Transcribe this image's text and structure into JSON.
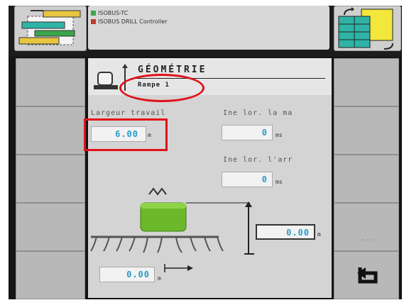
{
  "header": {
    "line1": "ISOBUS-TC",
    "line2": "ISOBUS DRILL Controller"
  },
  "screen": {
    "title": "GÉOMÉTRIE",
    "subtitle": "Rampe 1"
  },
  "fields": {
    "working_width": {
      "label": "Largeur travail",
      "value": "6.00",
      "unit": "m"
    },
    "delay_on_front": {
      "label": "Ine lor. la ma",
      "value": "0",
      "unit": "ms"
    },
    "delay_on_rear": {
      "label": "Ine lor. l'arr",
      "value": "0",
      "unit": "ms"
    },
    "height": {
      "value": "0.00",
      "unit": "m"
    },
    "offset": {
      "value": "0.00",
      "unit": "m"
    }
  },
  "softkeys": {
    "more": "...",
    "back_icon": "back-arrow-icon"
  },
  "colors": {
    "value_blue": "#2b9cc8",
    "highlight_red": "#e0101a",
    "machine_green": "#6bb82a"
  }
}
